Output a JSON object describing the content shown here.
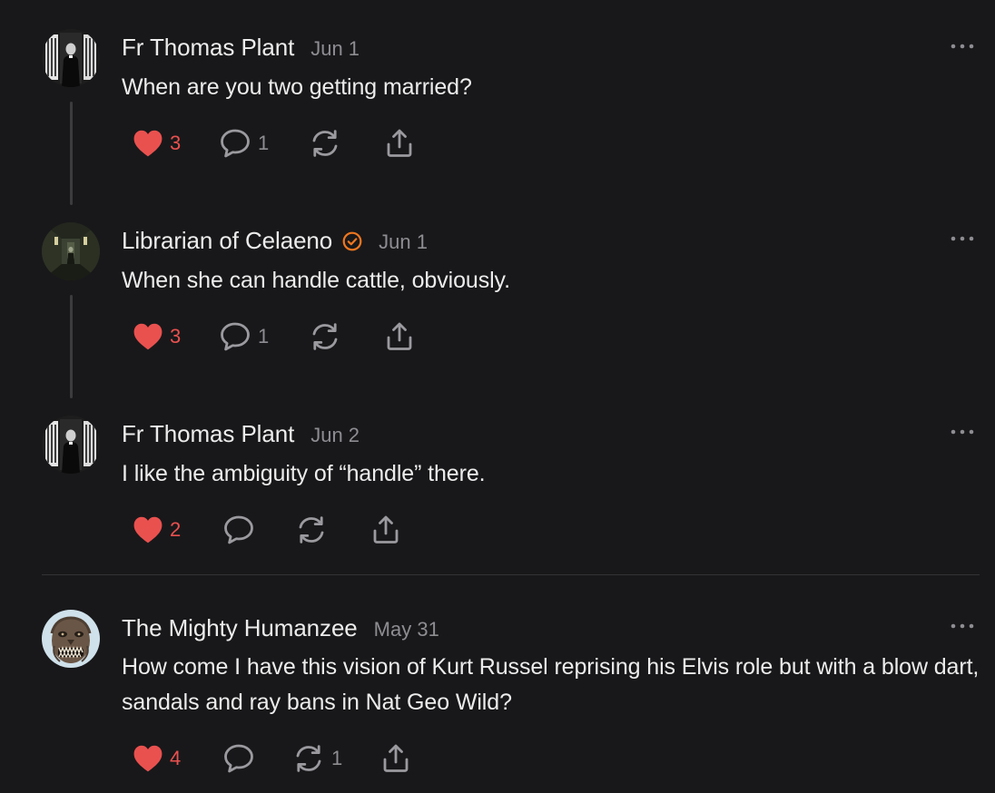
{
  "colors": {
    "background": "#18181a",
    "heart": "#e9514f",
    "verified": "#f0761f",
    "muted": "#8d8d92"
  },
  "comments": [
    {
      "author": "Fr Thomas Plant",
      "verified": false,
      "date": "Jun 1",
      "text": "When are you two getting married?",
      "likes": "3",
      "replies": "1",
      "restacks": "",
      "avatar_icon": "priest-photo-avatar"
    },
    {
      "author": "Librarian of Celaeno",
      "verified": true,
      "date": "Jun 1",
      "text": "When she can handle cattle, obviously.",
      "likes": "3",
      "replies": "1",
      "restacks": "",
      "avatar_icon": "dark-hallway-avatar"
    },
    {
      "author": "Fr Thomas Plant",
      "verified": false,
      "date": "Jun 2",
      "text": "I like the ambiguity of “handle” there.",
      "likes": "2",
      "replies": "",
      "restacks": "",
      "avatar_icon": "priest-photo-avatar"
    },
    {
      "author": "The Mighty Humanzee",
      "verified": false,
      "date": "May 31",
      "text": "How come I have this vision of Kurt Russel reprising his Elvis role but with a blow dart, sandals and ray bans in Nat Geo Wild?",
      "likes": "4",
      "replies": "",
      "restacks": "1",
      "avatar_icon": "creature-mask-avatar"
    }
  ]
}
